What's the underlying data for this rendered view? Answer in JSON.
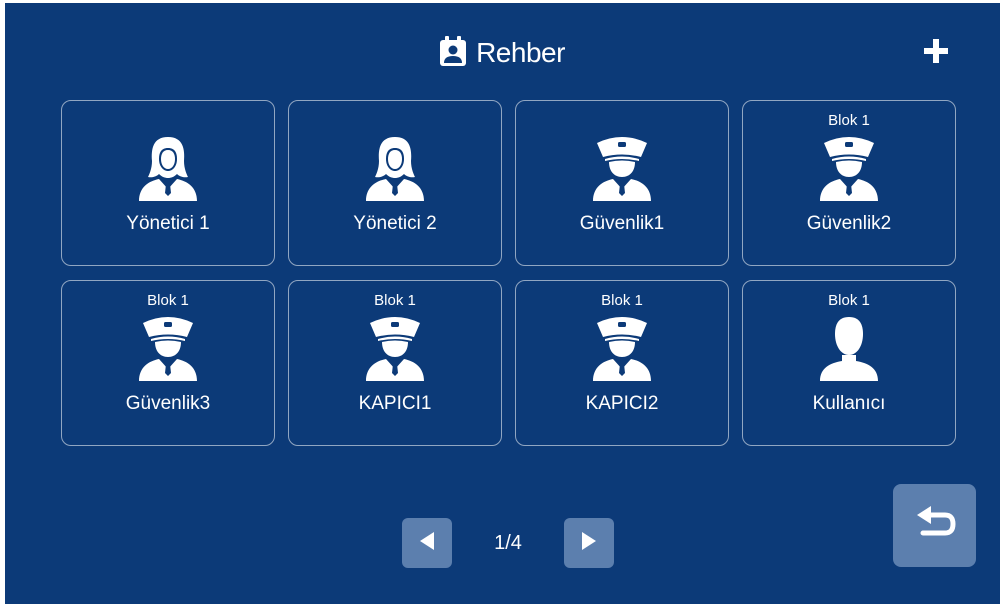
{
  "header": {
    "title": "Rehber",
    "title_icon": "contact-book-icon",
    "add_icon": "plus-icon"
  },
  "contacts": [
    {
      "sub": "",
      "label": "Yönetici 1",
      "icon": "female-user-icon"
    },
    {
      "sub": "",
      "label": "Yönetici 2",
      "icon": "female-user-icon"
    },
    {
      "sub": "",
      "label": "Güvenlik1",
      "icon": "security-guard-icon"
    },
    {
      "sub": "Blok 1",
      "label": "Güvenlik2",
      "icon": "security-guard-icon"
    },
    {
      "sub": "Blok 1",
      "label": "Güvenlik3",
      "icon": "security-guard-icon"
    },
    {
      "sub": "Blok 1",
      "label": "KAPICI1",
      "icon": "security-guard-icon"
    },
    {
      "sub": "Blok 1",
      "label": "KAPICI2",
      "icon": "security-guard-icon"
    },
    {
      "sub": "Blok 1",
      "label": "Kullanıcı",
      "icon": "male-user-icon"
    }
  ],
  "pagination": {
    "text": "1/4",
    "prev_icon": "prev-arrow-icon",
    "next_icon": "next-arrow-icon"
  },
  "back_icon": "return-arrow-icon",
  "colors": {
    "background": "#0c3a78",
    "button": "#5c7fae",
    "text": "#ffffff"
  }
}
